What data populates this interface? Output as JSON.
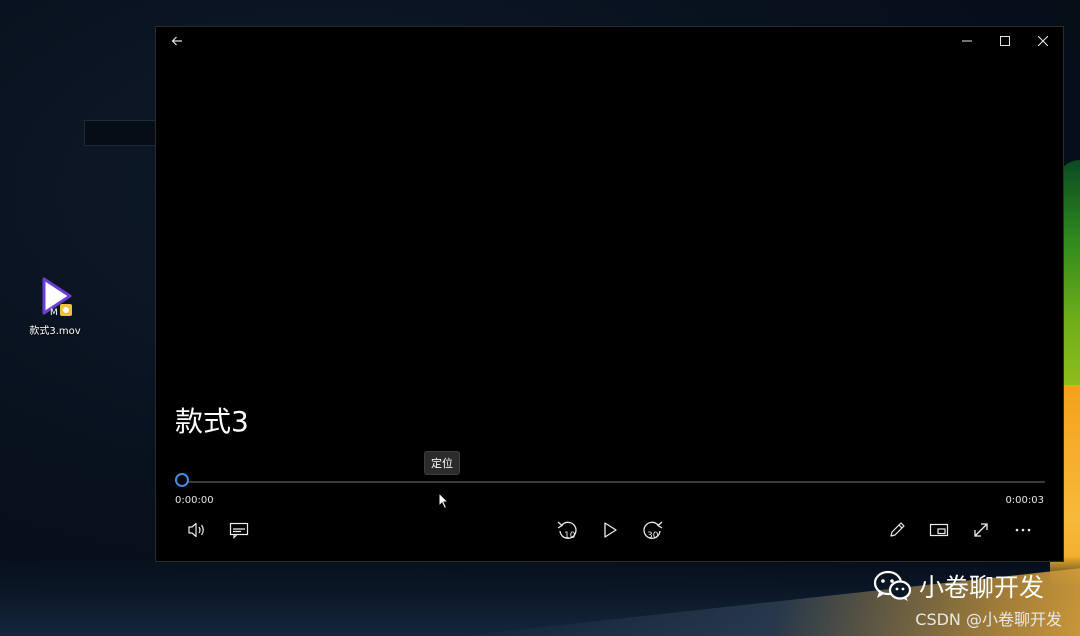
{
  "desktop": {
    "icon_label": "款式3.mov",
    "icon_badge": "M"
  },
  "player": {
    "title": "款式3",
    "tooltip": "定位",
    "time_current": "0:00:00",
    "time_total": "0:00:03",
    "progress": 0
  },
  "icons": {
    "back": "back-arrow-icon",
    "minimize": "minimize-icon",
    "maximize": "maximize-icon",
    "close": "close-icon",
    "volume": "volume-icon",
    "subtitles": "subtitles-icon",
    "rewind": "rewind-10-icon",
    "play": "play-icon",
    "forward": "forward-30-icon",
    "edit": "pencil-icon",
    "mini": "mini-view-icon",
    "fullscreen": "fullscreen-icon",
    "more": "more-icon"
  },
  "controls": {
    "rewind_seconds": "10",
    "forward_seconds": "30"
  },
  "watermark": {
    "brand": "小卷聊开发",
    "csdn": "CSDN @小卷聊开发"
  },
  "colors": {
    "accent": "#4a8be0",
    "window_bg": "#000000"
  }
}
